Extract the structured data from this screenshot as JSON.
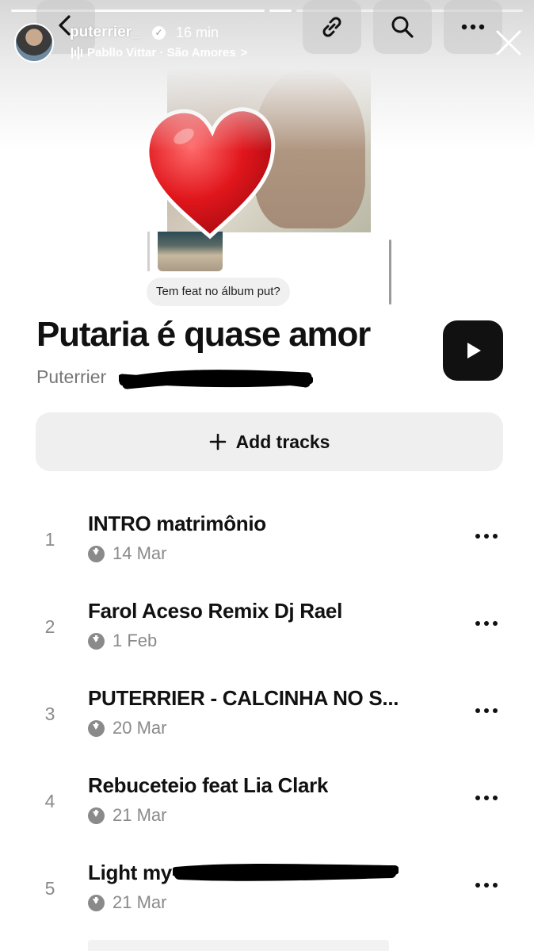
{
  "story": {
    "username": "puterrier_",
    "time_ago": "16 min",
    "music": "Pabllo Vittar · São Amores",
    "music_chevron": ">"
  },
  "shared_post": {
    "reply_text": "Tem feat no álbum put?"
  },
  "playlist": {
    "title": "Putaria é quase amor",
    "owner": "Puterrier",
    "add_tracks_label": "Add tracks",
    "tracks": [
      {
        "number": "1",
        "name": "INTRO matrimônio",
        "date": "14 Mar"
      },
      {
        "number": "2",
        "name": "Farol Aceso Remix Dj Rael",
        "date": "1 Feb"
      },
      {
        "number": "3",
        "name": "PUTERRIER - CALCINHA NO S...",
        "date": "20 Mar"
      },
      {
        "number": "4",
        "name": "Rebuceteio feat Lia Clark",
        "date": "21 Mar"
      },
      {
        "number": "5",
        "name": "Light my",
        "date": "21 Mar"
      }
    ]
  },
  "colors": {
    "text": "#111111",
    "muted": "#8a8a8a",
    "button_bg": "#efefef",
    "play_bg": "#111111"
  },
  "icons": [
    "back-icon",
    "link-icon",
    "search-icon",
    "more-icon",
    "close-icon",
    "verified-icon",
    "music-bars-icon",
    "heart-sticker-icon",
    "play-icon",
    "plus-icon",
    "download-icon"
  ]
}
